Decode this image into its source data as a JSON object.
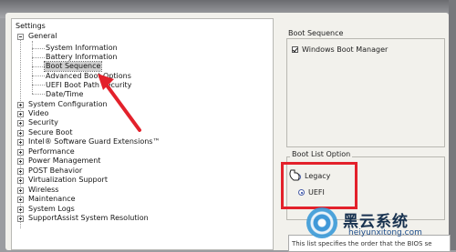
{
  "tree": {
    "title": "Settings",
    "nodes": [
      {
        "label": "General",
        "expanded": true
      },
      {
        "label": "System Information"
      },
      {
        "label": "Battery Information"
      },
      {
        "label": "Boot Sequence",
        "selected": true
      },
      {
        "label": "Advanced Boot Options"
      },
      {
        "label": "UEFI Boot Path Security"
      },
      {
        "label": "Date/Time"
      },
      {
        "label": "System Configuration",
        "expanded": false
      },
      {
        "label": "Video"
      },
      {
        "label": "Security"
      },
      {
        "label": "Secure Boot"
      },
      {
        "label": "Intel® Software Guard Extensions™"
      },
      {
        "label": "Performance"
      },
      {
        "label": "Power Management"
      },
      {
        "label": "POST Behavior"
      },
      {
        "label": "Virtualization Support"
      },
      {
        "label": "Wireless"
      },
      {
        "label": "Maintenance"
      },
      {
        "label": "System Logs"
      },
      {
        "label": "SupportAssist System Resolution"
      }
    ]
  },
  "boot_sequence": {
    "title": "Boot Sequence",
    "items": [
      {
        "label": "Windows Boot Manager",
        "checked": true
      }
    ]
  },
  "boot_list_option": {
    "title": "Boot List Option",
    "options": [
      {
        "label": "Legacy",
        "selected": false
      },
      {
        "label": "UEFI",
        "selected": true
      }
    ]
  },
  "info_text": "This list specifies the order that the BIOS se",
  "watermark": {
    "brand_cn": "黑云系统",
    "url": "heiyunxitong.com"
  },
  "colors": {
    "annotation_red": "#e3212b",
    "selection_gray": "#cfcfcf"
  }
}
